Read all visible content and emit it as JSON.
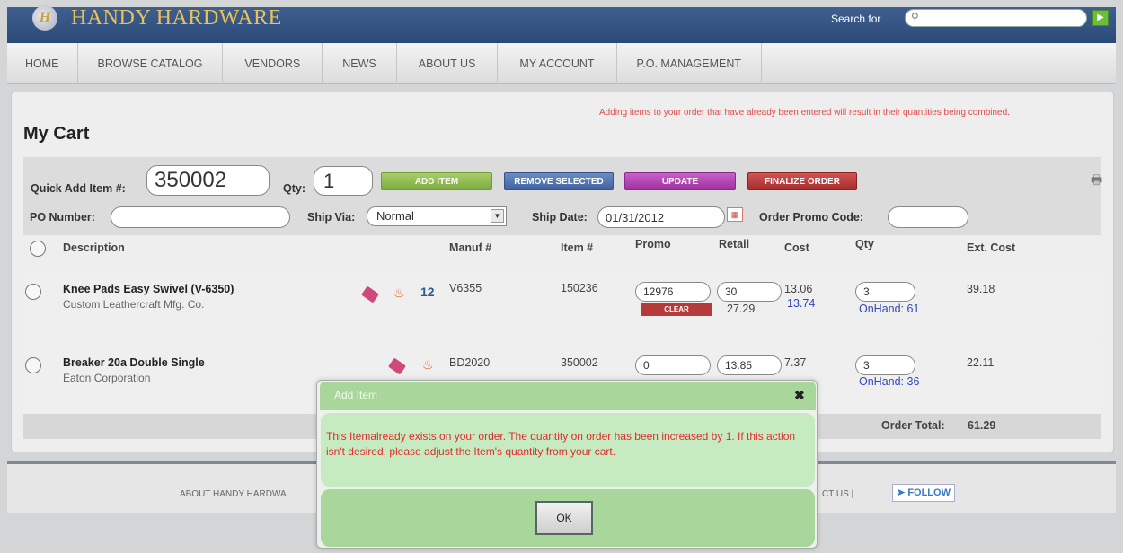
{
  "header": {
    "logo_letter": "H",
    "brand": "HANDY HARDWARE",
    "search_label": "Search for",
    "search_value": "",
    "go_glyph": "▶"
  },
  "nav": [
    "HOME",
    "BROWSE CATALOG",
    "VENDORS",
    "NEWS",
    "ABOUT US",
    "MY ACCOUNT",
    "P.O. MANAGEMENT"
  ],
  "notice": "Adding items to your order that have already been entered will result in their quantities being combined.",
  "page_title": "My Cart",
  "toolbar": {
    "quick_add_label": "Quick Add Item #:",
    "quick_add_value": "350002",
    "qty_label": "Qty:",
    "qty_value": "1",
    "add_item": "ADD ITEM",
    "remove_selected": "REMOVE SELECTED",
    "update": "UPDATE",
    "finalize": "FINALIZE ORDER",
    "po_label": "PO Number:",
    "po_value": "",
    "ship_via_label": "Ship Via:",
    "ship_via_value": "Normal",
    "ship_date_label": "Ship Date:",
    "ship_date_value": "01/31/2012",
    "promo_code_label": "Order Promo Code:",
    "promo_code_value": ""
  },
  "columns": {
    "description": "Description",
    "manuf": "Manuf #",
    "item": "Item #",
    "promo": "Promo",
    "retail": "Retail",
    "cost": "Cost",
    "qty": "Qty",
    "ext_cost": "Ext. Cost"
  },
  "items": [
    {
      "name": "Knee Pads Easy Swivel (V-6350)",
      "vendor": "Custom Leathercraft Mfg. Co.",
      "badge": "12",
      "manuf": "V6355",
      "item": "150236",
      "promo": "12976",
      "clear": "CLEAR",
      "retail": "30",
      "retail_sub": "27.29",
      "cost": "13.06",
      "cost_sub": "13.74",
      "qty": "3",
      "onhand": "OnHand: 61",
      "ext_cost": "39.18"
    },
    {
      "name": "Breaker 20a Double Single",
      "vendor": "Eaton Corporation",
      "manuf": "BD2020",
      "item": "350002",
      "promo": "0",
      "retail": "13.85",
      "cost": "7.37",
      "qty": "3",
      "onhand": "OnHand: 36",
      "ext_cost": "22.11"
    }
  ],
  "order_total_label": "Order Total:",
  "order_total_value": "61.29",
  "footer": {
    "about": "ABOUT HANDY HARDWA",
    "contact": "CT US |",
    "follow": "FOLLOW"
  },
  "modal": {
    "title": "Add Item",
    "close_glyph": "✖",
    "message": "This Itemalready exists on your order. The quantity on order has been increased by 1. If this action isn't desired, please adjust the Item's quantity from your cart.",
    "ok": "OK"
  },
  "colors": {
    "brand_gold": "#e9c15a",
    "header_blue": "#2b4a78",
    "alert_red": "#e02b2b",
    "modal_green": "#a9d69a"
  }
}
